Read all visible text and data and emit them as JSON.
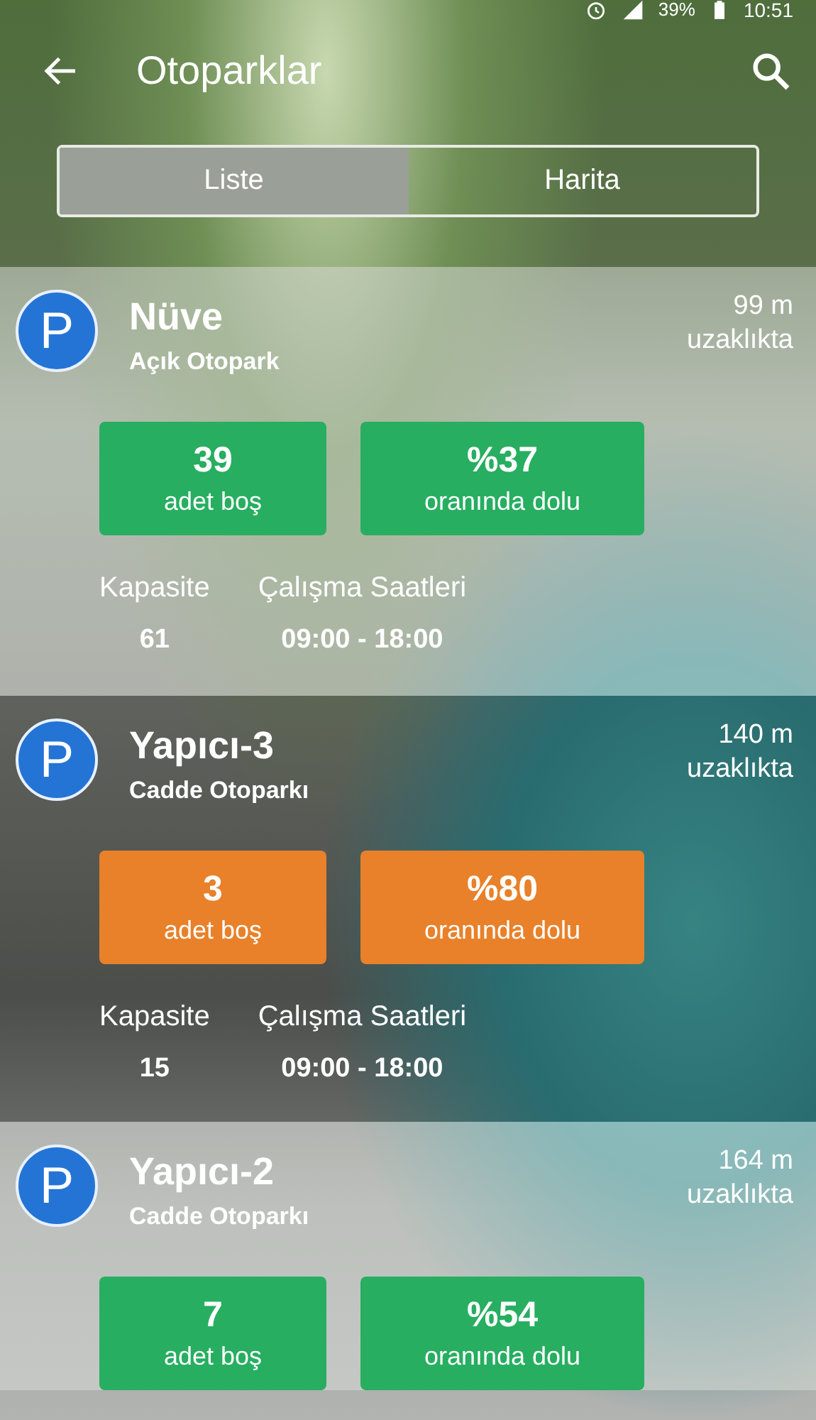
{
  "status_bar": {
    "battery": "39%",
    "time": "10:51"
  },
  "app_bar": {
    "title": "Otoparklar"
  },
  "tabs": [
    {
      "label": "Liste",
      "selected": true
    },
    {
      "label": "Harita",
      "selected": false
    }
  ],
  "parkings": [
    {
      "icon_letter": "P",
      "name": "Nüve",
      "type": "Açık Otopark",
      "distance": "99 m",
      "distance_unit": "uzaklıkta",
      "color": "#27ae60",
      "free": "39",
      "free_label": "adet boş",
      "occupancy": "%37",
      "occupancy_label": "oranında dolu",
      "capacity_label": "Kapasite",
      "capacity": "61",
      "hours_label": "Çalışma Saatleri",
      "hours": "09:00 - 18:00"
    },
    {
      "icon_letter": "P",
      "name": "Yapıcı-3",
      "type": "Cadde Otoparkı",
      "distance": "140 m",
      "distance_unit": "uzaklıkta",
      "color": "#e8812a",
      "free": "3",
      "free_label": "adet boş",
      "occupancy": "%80",
      "occupancy_label": "oranında dolu",
      "capacity_label": "Kapasite",
      "capacity": "15",
      "hours_label": "Çalışma Saatleri",
      "hours": "09:00 - 18:00"
    },
    {
      "icon_letter": "P",
      "name": "Yapıcı-2",
      "type": "Cadde Otoparkı",
      "distance": "164 m",
      "distance_unit": "uzaklıkta",
      "color": "#27ae60",
      "free": "7",
      "free_label": "adet boş",
      "occupancy": "%54",
      "occupancy_label": "oranında dolu"
    }
  ]
}
